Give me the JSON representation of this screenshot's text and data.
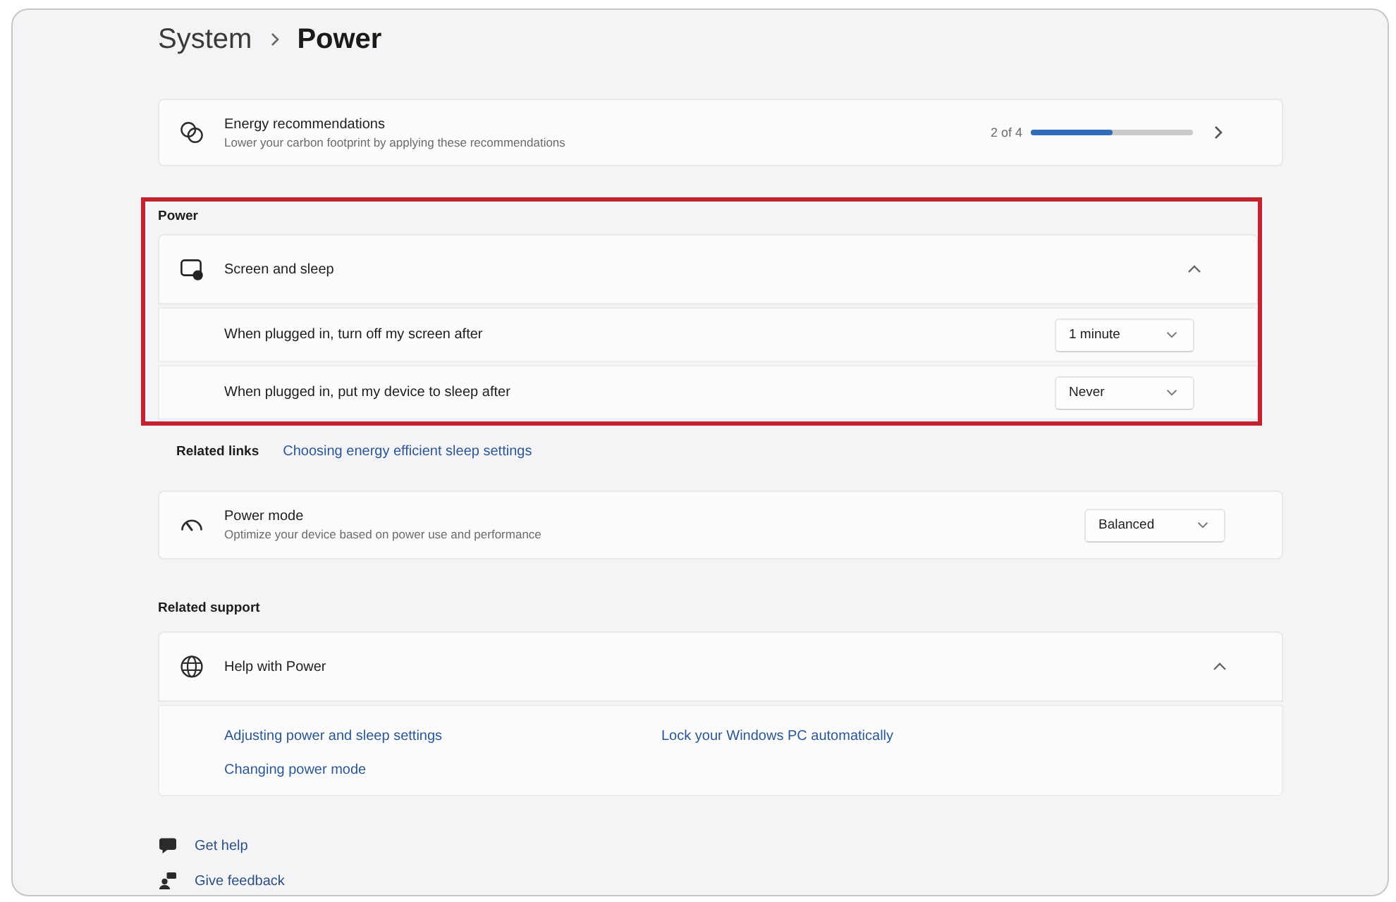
{
  "breadcrumb": {
    "parent": "System",
    "current": "Power"
  },
  "energy_card": {
    "title": "Energy recommendations",
    "subtitle": "Lower your carbon footprint by applying these recommendations",
    "progress_text": "2 of 4",
    "level": 0.5
  },
  "power_section": {
    "heading": "Power",
    "highlighted": true,
    "expander": {
      "title": "Screen and sleep",
      "expanded": true,
      "settings": [
        {
          "label": "When plugged in, turn off my screen after",
          "value": "1 minute"
        },
        {
          "label": "When plugged in, put my device to sleep after",
          "value": "Never"
        }
      ]
    }
  },
  "related_links": {
    "label": "Related links",
    "link": "Choosing energy efficient sleep settings"
  },
  "power_mode": {
    "title": "Power mode",
    "subtitle": "Optimize your device based on power use and performance",
    "value": "Balanced"
  },
  "related_support": {
    "heading": "Related support",
    "expander": {
      "title": "Help with Power",
      "expanded": true,
      "links": [
        "Adjusting power and sleep settings",
        "Changing power mode",
        "Lock your Windows PC automatically"
      ]
    }
  },
  "footer_links": [
    {
      "kind": "help",
      "label": "Get help"
    },
    {
      "kind": "feedback",
      "label": "Give feedback"
    }
  ]
}
